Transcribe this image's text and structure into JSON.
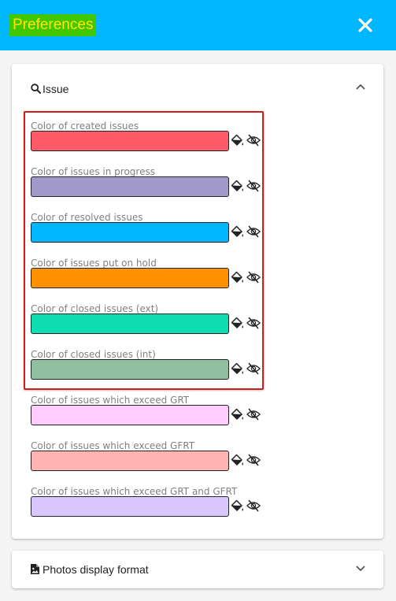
{
  "header": {
    "title": "Preferences",
    "title_bg": "#41c700",
    "title_color": "#ffe600",
    "bg_color": "#00b7ff",
    "close_icon": "close-icon"
  },
  "issue_section": {
    "title": "Issue",
    "icon": "search-icon",
    "expanded": true,
    "colors": [
      {
        "label": "Color of created issues",
        "color": "#ff5a67",
        "highlighted": true
      },
      {
        "label": "Color of issues in progress",
        "color": "#a099c9",
        "highlighted": true
      },
      {
        "label": "Color of resolved issues",
        "color": "#00b7ff",
        "highlighted": true
      },
      {
        "label": "Color of issues put on hold",
        "color": "#ff9100",
        "highlighted": true
      },
      {
        "label": "Color of closed issues (ext)",
        "color": "#0dddb1",
        "highlighted": true
      },
      {
        "label": "Color of closed issues (int)",
        "color": "#8fbf9f",
        "highlighted": true
      },
      {
        "label": "Color of issues which exceed GRT",
        "color": "#ffccfe",
        "highlighted": false
      },
      {
        "label": "Color of issues which exceed GFRT",
        "color": "#ffb3b3",
        "highlighted": false
      },
      {
        "label": "Color of issues which exceed GRT and GFRT",
        "color": "#dbc7ff",
        "highlighted": false
      }
    ]
  },
  "photos_section": {
    "title": "Photos display format",
    "icon": "image-file-icon",
    "expanded": false
  }
}
